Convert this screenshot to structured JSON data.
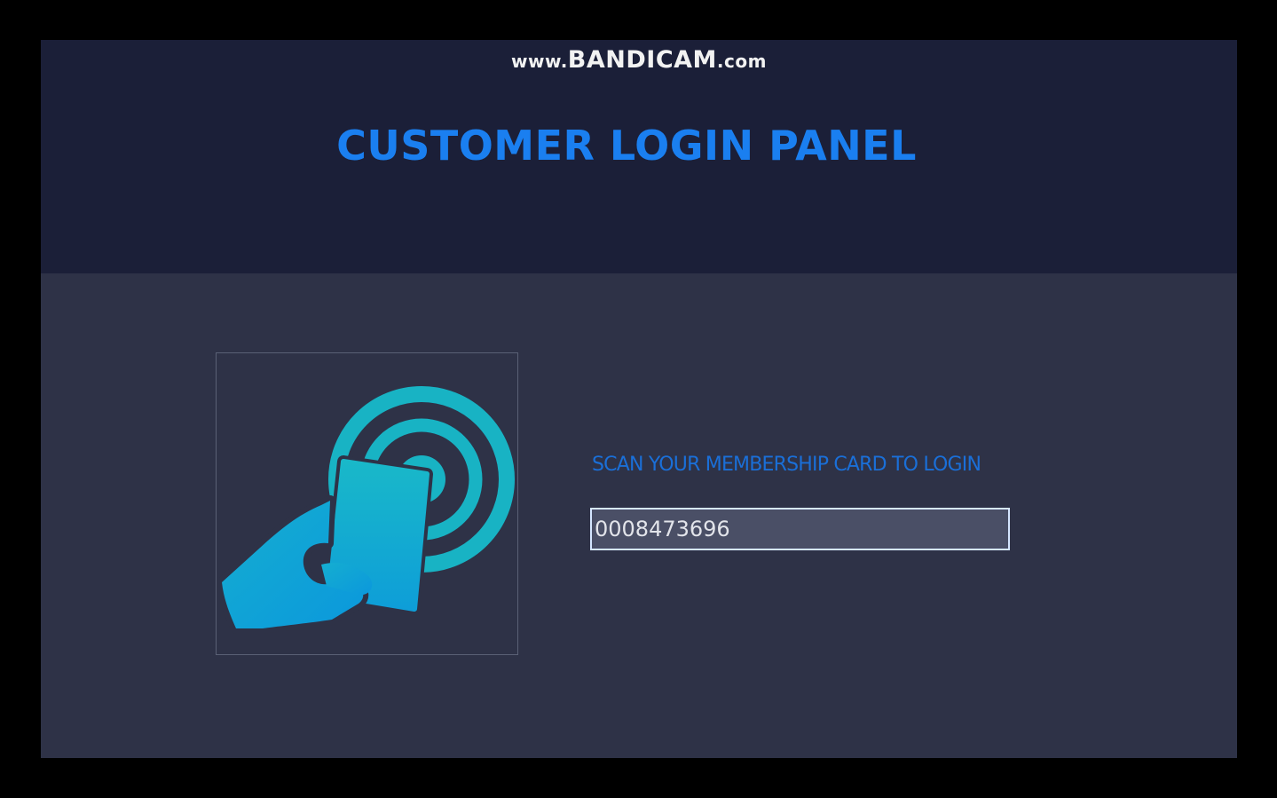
{
  "watermark": {
    "prefix": "www.",
    "brand": "BANDICAM",
    "suffix": ".com"
  },
  "header": {
    "title": "CUSTOMER LOGIN PANEL"
  },
  "login": {
    "instruction": "SCAN YOUR MEMBERSHIP CARD TO LOGIN",
    "card_number": "0008473696"
  },
  "illustration": {
    "icon": "hand-scanning-card-icon"
  },
  "colors": {
    "background": "#000000",
    "window": "#2e3247",
    "header_band": "#1b1f38",
    "title": "#1a7ff0",
    "instruction": "#1a6fd8",
    "input_bg": "#4a4f66",
    "input_border": "#d5e6ff",
    "icon_ring": "#18b3c4",
    "icon_card": "#11a6d3"
  }
}
